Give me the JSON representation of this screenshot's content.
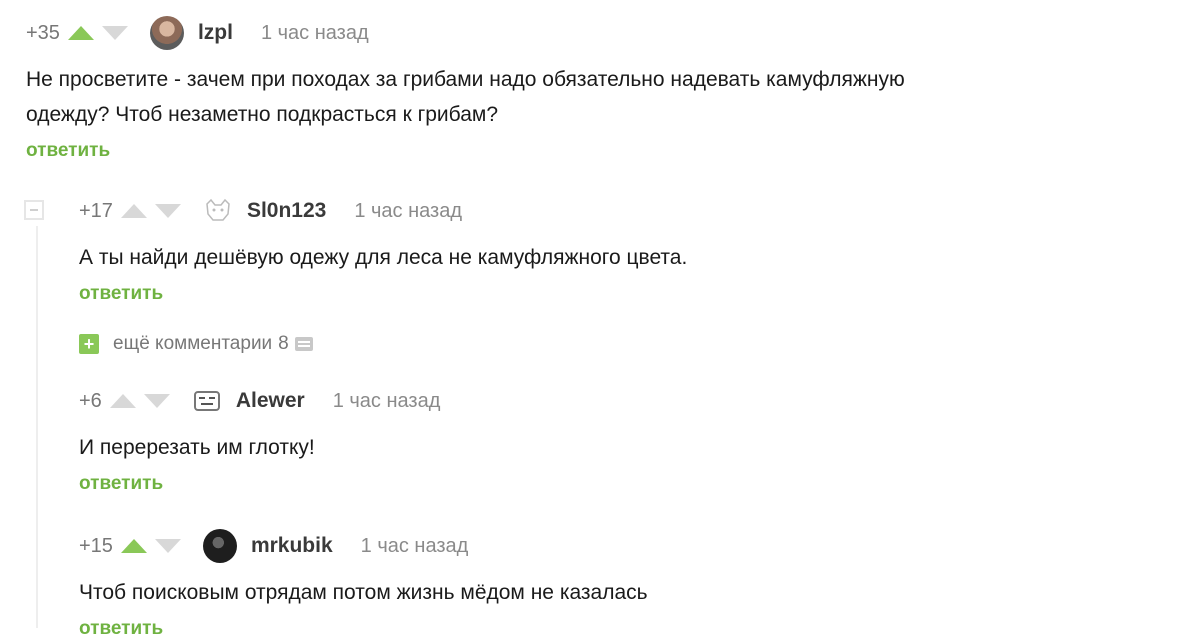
{
  "reply_label": "ответить",
  "comments": [
    {
      "rating": "+35",
      "author": "lzpl",
      "time": "1 час назад",
      "text_lines": [
        "Не просветите - зачем при походах за грибами надо обязательно надевать камуфляжную",
        "одежду? Чтоб незаметно подкрасться к грибам?"
      ]
    },
    {
      "rating": "+17",
      "author": "Sl0n123",
      "time": "1 час назад",
      "text_lines": [
        "А ты найди дешёвую одежу для леса не камуфляжного цвета."
      ]
    },
    {
      "rating": "+6",
      "author": "Alewer",
      "time": "1 час назад",
      "text_lines": [
        "И перерезать им глотку!"
      ]
    },
    {
      "rating": "+15",
      "author": "mrkubik",
      "time": "1 час назад",
      "text_lines": [
        "Чтоб поисковым отрядам потом жизнь мёдом не казалась"
      ]
    }
  ],
  "more_comments": {
    "label": "ещё комментарии",
    "count": "8"
  },
  "colors": {
    "accent": "#8ac858",
    "reply": "#6fb241",
    "muted": "#8a8a8a"
  }
}
